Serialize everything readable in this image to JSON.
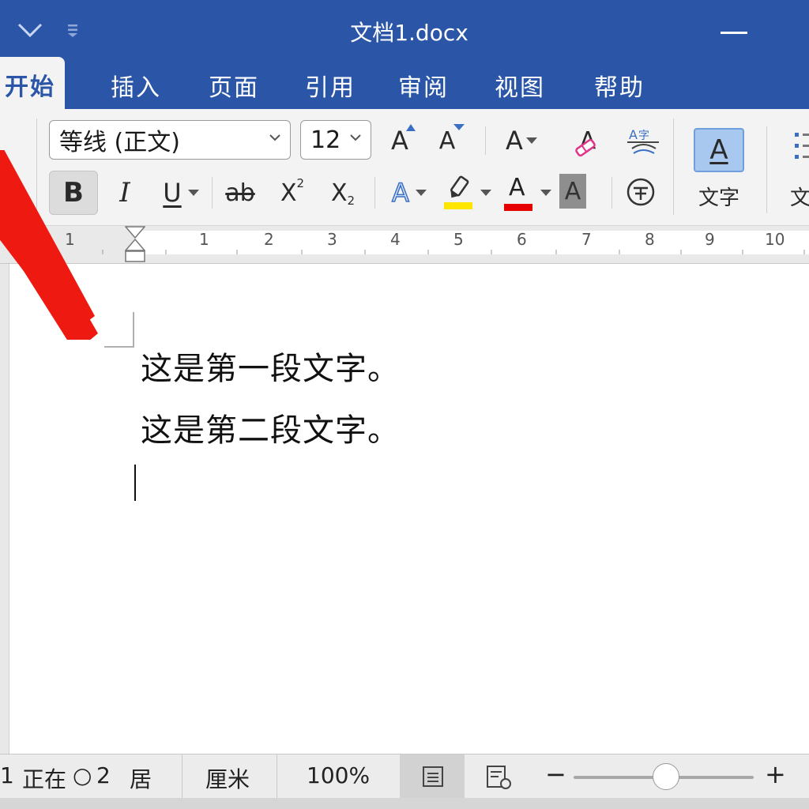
{
  "window": {
    "title": "文档1.docx"
  },
  "tabs": [
    {
      "label": "开始",
      "active": true
    },
    {
      "label": "插入"
    },
    {
      "label": "页面"
    },
    {
      "label": "引用"
    },
    {
      "label": "审阅"
    },
    {
      "label": "视图"
    },
    {
      "label": "帮助"
    }
  ],
  "font": {
    "name": "等线 (正文)",
    "size": "12"
  },
  "styles": {
    "label": "文字",
    "label2": "文"
  },
  "toolbar": {
    "bold": "B",
    "italic": "I",
    "underline": "U",
    "strike": "ab",
    "superscript": "X",
    "superscript_mark": "2",
    "subscript": "X",
    "subscript_mark": "2",
    "grow": "A",
    "shrink": "A",
    "case": "A",
    "clear": "A",
    "effects": "A",
    "highlight_color": "#ffe600",
    "font_color": "#e60000",
    "font_color_label": "A",
    "shading": "A",
    "style_glyph": "A"
  },
  "ruler": {
    "labels": [
      "1",
      "1",
      "2",
      "3",
      "4",
      "5",
      "6",
      "7",
      "8",
      "9",
      "10"
    ]
  },
  "document": {
    "paragraphs": [
      "这是第一段文字。",
      "这是第二段文字。"
    ]
  },
  "status": {
    "page": "1",
    "state": "正在",
    "circle": "○",
    "count": "2",
    "mode": "居",
    "unit": "厘米",
    "zoom": "100%",
    "zoom_minus": "−",
    "zoom_plus": "+"
  },
  "colors": {
    "brand": "#2b56a8",
    "ribbon": "#f3f3f3",
    "arrow": "#ee1a12"
  }
}
